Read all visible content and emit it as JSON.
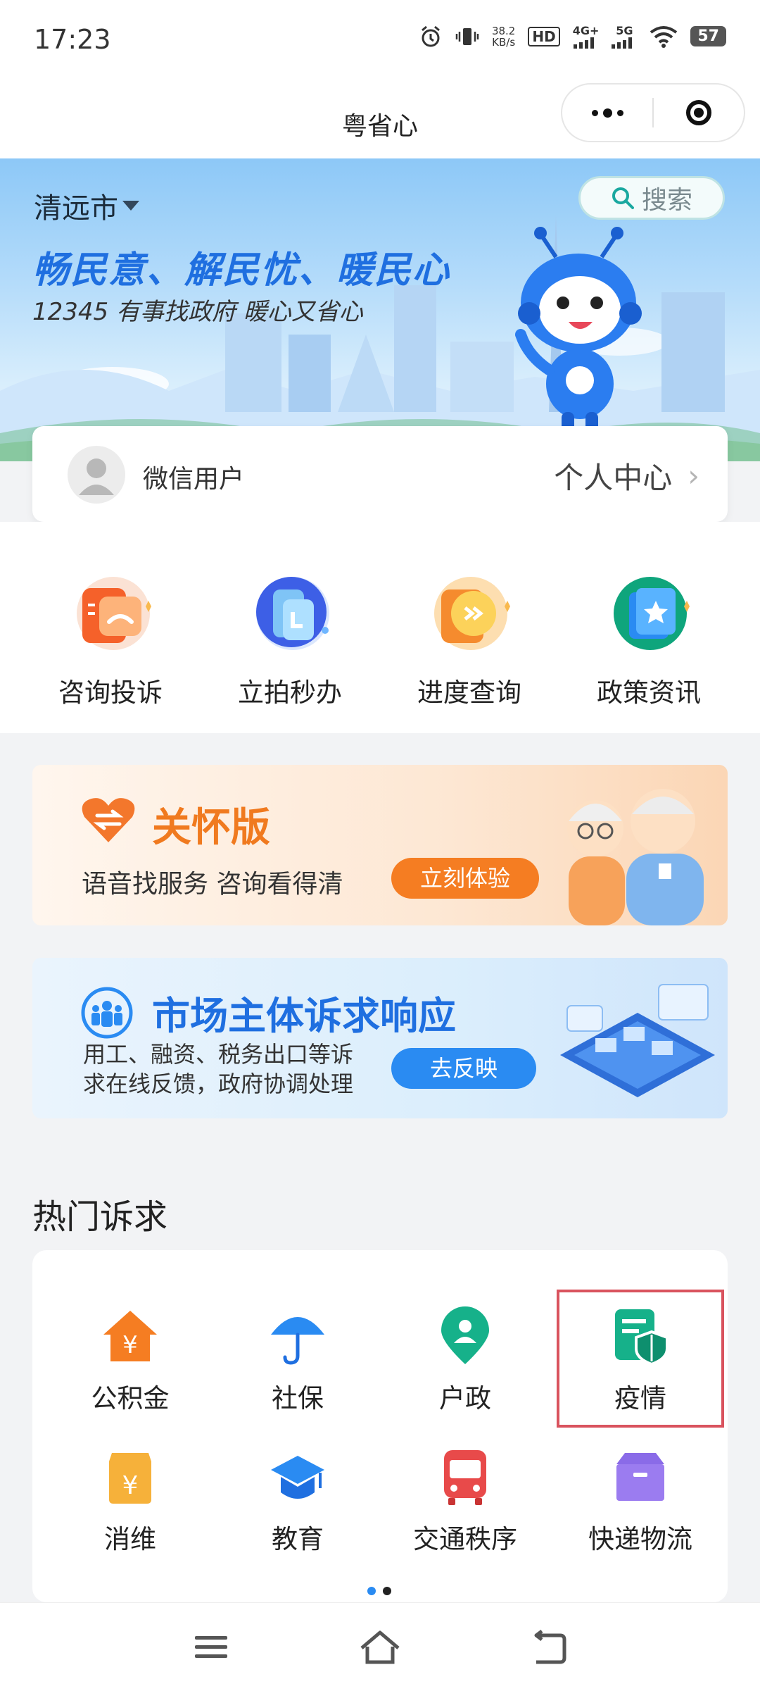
{
  "status_bar": {
    "time": "17:23",
    "net_speed_value": "38.2",
    "net_speed_unit": "KB/s",
    "hd_label": "HD",
    "signal1_label": "4G+",
    "signal2_label": "5G",
    "battery": "57"
  },
  "app": {
    "title": "粤省心"
  },
  "banner": {
    "city": "清远市",
    "search_placeholder": "搜索",
    "slogan": "畅民意、解民忧、暖民心",
    "subslogan": "12345 有事找政府 暖心又省心"
  },
  "user_card": {
    "username": "微信用户",
    "center_label": "个人中心"
  },
  "quick_actions": [
    {
      "label": "咨询投诉",
      "icon": "consult-icon",
      "color": "#f5612a"
    },
    {
      "label": "立拍秒办",
      "icon": "camera-icon",
      "color": "#2f7bf0"
    },
    {
      "label": "进度查询",
      "icon": "progress-icon",
      "color": "#f6a21c"
    },
    {
      "label": "政策资讯",
      "icon": "policy-icon",
      "color": "#16b18a"
    }
  ],
  "promo_care": {
    "title": "关怀版",
    "subtitle": "语音找服务 咨询看得清",
    "button": "立刻体验"
  },
  "promo_market": {
    "title": "市场主体诉求响应",
    "line1": "用工、融资、税务出口等诉",
    "line2": "求在线反馈，政府协调处理",
    "button": "去反映"
  },
  "hot": {
    "title": "热门诉求",
    "items": [
      {
        "label": "公积金",
        "icon": "housing-fund-icon"
      },
      {
        "label": "社保",
        "icon": "umbrella-icon"
      },
      {
        "label": "户政",
        "icon": "location-person-icon"
      },
      {
        "label": "疫情",
        "icon": "shield-doc-icon"
      },
      {
        "label": "消维",
        "icon": "consumer-yuan-icon"
      },
      {
        "label": "教育",
        "icon": "grad-cap-icon"
      },
      {
        "label": "交通秩序",
        "icon": "bus-icon"
      },
      {
        "label": "快递物流",
        "icon": "package-icon"
      }
    ]
  },
  "colors": {
    "accent_blue": "#1f6fe0",
    "accent_orange": "#f57d22",
    "highlight_red": "#d9535e"
  }
}
